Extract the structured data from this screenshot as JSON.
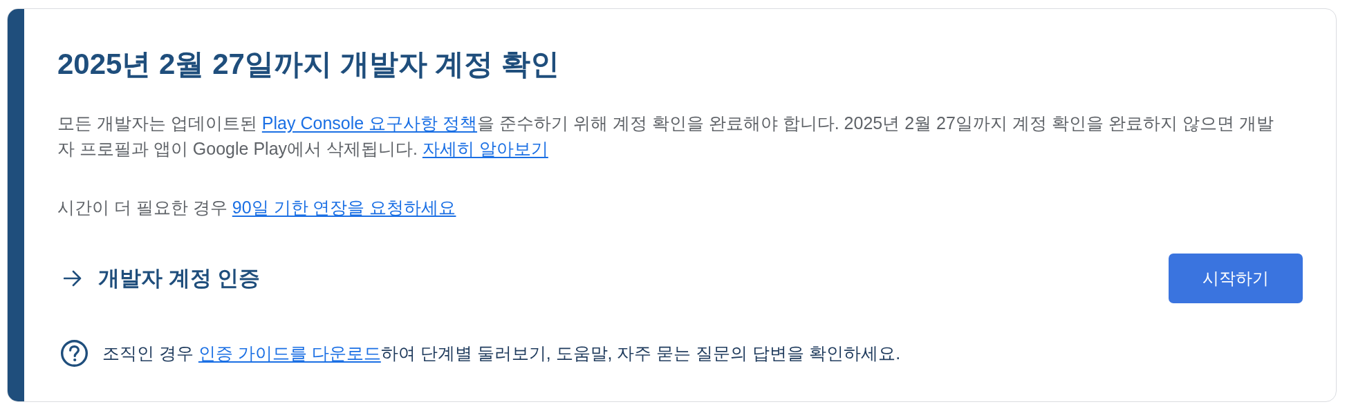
{
  "card": {
    "title": "2025년 2월 27일까지 개발자 계정 확인",
    "paragraphs": [
      {
        "parts": [
          {
            "kind": "text",
            "text": "모든 개발자는 업데이트된 "
          },
          {
            "kind": "link",
            "text": "Play Console 요구사항 정책"
          },
          {
            "kind": "text",
            "text": "을 준수하기 위해 계정 확인을 완료해야 합니다. 2025년 2월 27일까지 계정 확인을 완료하지 않으면 개발자 프로필과 앱이 Google Play에서 삭제됩니다. "
          },
          {
            "kind": "link",
            "text": "자세히 알아보기"
          }
        ]
      },
      {
        "parts": [
          {
            "kind": "text",
            "text": "시간이 더 필요한 경우 "
          },
          {
            "kind": "link",
            "text": "90일 기한 연장을 요청하세요"
          }
        ]
      }
    ],
    "task": {
      "label": "개발자 계정 인증",
      "button": "시작하기"
    },
    "help": {
      "parts": [
        {
          "kind": "text",
          "text": "조직인 경우 "
        },
        {
          "kind": "link",
          "text": "인증 가이드를 다운로드"
        },
        {
          "kind": "text",
          "text": "하여 단계별 둘러보기, 도움말, 자주 묻는 질문의 답변을 확인하세요."
        }
      ]
    }
  }
}
